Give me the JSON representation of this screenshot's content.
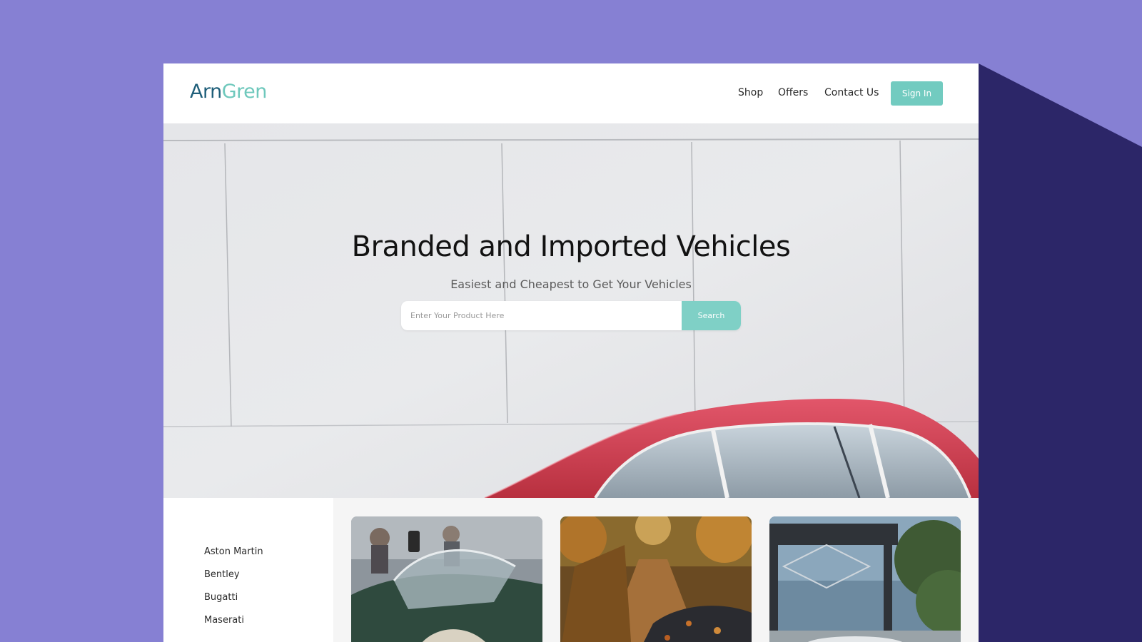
{
  "header": {
    "logo_part1": "Arn",
    "logo_part2": "Gren",
    "nav": [
      "Shop",
      "Offers",
      "Contact Us"
    ],
    "signin_label": "Sign In"
  },
  "hero": {
    "title": "Branded and Imported Vehicles",
    "subtitle": "Easiest and Cheapest to Get Your Vehicles",
    "search_placeholder": "Enter Your Product Here",
    "search_button": "Search"
  },
  "brands": [
    "Aston Martin",
    "Bentley",
    "Bugatti",
    "Maserati"
  ],
  "colors": {
    "page_background": "#8680d3",
    "dark_corner": "#2c2668",
    "accent": "#72cbc0",
    "logo_dark": "#1f5f7a",
    "logo_light": "#6ec8bc",
    "car_red": "#d63f52"
  }
}
